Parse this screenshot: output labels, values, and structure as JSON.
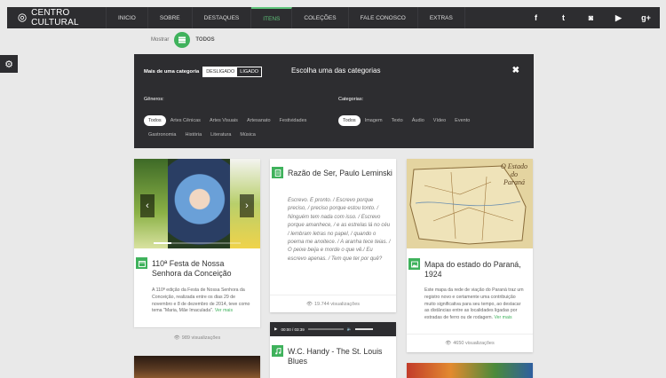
{
  "header": {
    "logo_text": "CENTRO CULTURAL",
    "nav": [
      {
        "label": "INICIO",
        "active": false
      },
      {
        "label": "SOBRE",
        "active": false
      },
      {
        "label": "DESTAQUES",
        "active": false
      },
      {
        "label": "ITENS",
        "active": true
      },
      {
        "label": "COLEÇÕES",
        "active": false
      },
      {
        "label": "FALE CONOSCO",
        "active": false
      },
      {
        "label": "EXTRAS",
        "active": false
      }
    ],
    "social": [
      {
        "icon": "facebook-icon",
        "glyph": "f"
      },
      {
        "icon": "twitter-icon",
        "glyph": "t"
      },
      {
        "icon": "instagram-icon",
        "glyph": "◙"
      },
      {
        "icon": "youtube-icon",
        "glyph": "▶"
      },
      {
        "icon": "googleplus-icon",
        "glyph": "g+"
      }
    ]
  },
  "filter_bar": {
    "show_label": "Mostrar",
    "current": "TODOS"
  },
  "panel": {
    "multi_label": "Mais de uma categoria",
    "off_label": "DESLIGADO",
    "on_label": "LIGADO",
    "title": "Escolha uma das categorias",
    "close": "✖",
    "genres_heading": "Gêneros:",
    "genres": [
      "Todos",
      "Artes Cênicas",
      "Artes Visuais",
      "Artesanato",
      "Festividades",
      "Gastronomia",
      "História",
      "Literatura",
      "Música"
    ],
    "categories_heading": "Categorias:",
    "categories": [
      "Todos",
      "Imagem",
      "Texto",
      "Áudio",
      "Vídeo",
      "Evento"
    ]
  },
  "cards": {
    "festa": {
      "title": "110ª Festa de Nossa Senhora da Conceição",
      "desc": "A 110ª edição da Festa de Nossa Senhora da Conceição, realizada entre os dias 29 de novembro e 8 de dezembro de 2014, teve como tema \"Maria, Mãe Imaculada\".",
      "more": "Ver mais",
      "views": "989 visualizações"
    },
    "razao": {
      "title": "Razão de Ser, Paulo Leminski",
      "quote": "Escrevo. E pronto. / Escrevo porque preciso, / preciso porque estou tonto. / Ninguém tem nada com isso. / Escrevo porque amanhece, / e as estrelas lá no céu / lembram letras no papel, / quando o poema me anoitece. / A aranha tece teias. / O peixe beija e morde o que vê./ Eu escrevo apenas. / Tem que ter por quê?",
      "views": "19.744 visualizações"
    },
    "mapa": {
      "title": "Mapa do estado do Paraná, 1924",
      "desc": "Este mapa da rede de viação do Paraná traz um registro novo e certamente uma contribuição muito significativa para seu tempo, ao destacar as distâncias entre as localidades ligadas por estradas de ferro ou de rodagem.",
      "more": "Ver mais",
      "map_caption": "O Estado do Paraná",
      "views": "4650 visualizações"
    },
    "handy": {
      "time": "00:00 / 03:39",
      "title": "W.C. Handy - The St. Louis Blues"
    }
  }
}
